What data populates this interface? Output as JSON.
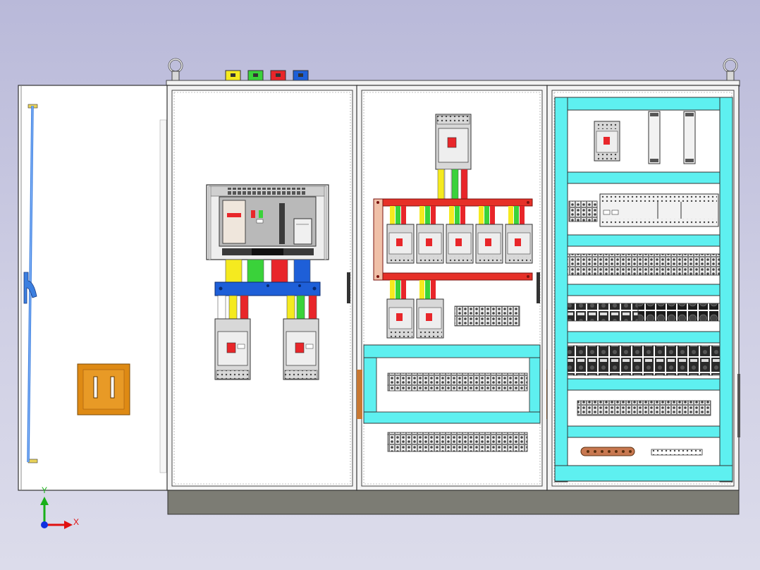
{
  "cad_view": {
    "axis_triad": {
      "x_label": "X",
      "y_label": "Y",
      "x_color": "#e01010",
      "y_color": "#19b019",
      "z_color": "#1030e0"
    }
  },
  "cabinet": {
    "colors": {
      "phase_yellow": "#f5ea1f",
      "phase_green": "#3ad23a",
      "phase_red": "#e8262a",
      "neutral_blue": "#1e5fd8",
      "busbar_red": "#e63028",
      "mounting_rail_cyan": "#5ef0f0",
      "plinth_gray": "#7c7c74",
      "door_lock_orange": "#de8a14",
      "copper_bar": "#c87850"
    },
    "phase_terminal_caps": [
      "yellow",
      "green",
      "red",
      "blue"
    ],
    "sections": [
      {
        "name": "hinged-door",
        "contents": [
          "door-handle-rod",
          "lock-plate"
        ]
      },
      {
        "name": "incoming-section",
        "contents": [
          "air-circuit-breaker",
          "neutral-busbar",
          "molded-case-breaker",
          "molded-case-breaker"
        ]
      },
      {
        "name": "distribution-section",
        "contents": [
          "main-breaker",
          "phase-busbar-frame",
          "outgoing-breakers-5",
          "outgoing-breakers-2",
          "terminal-rows"
        ]
      },
      {
        "name": "control-section",
        "contents": [
          "control-breaker",
          "din-rail-modules",
          "plc-modules",
          "relay-rows",
          "terminal-strip",
          "copper-ground-bar"
        ]
      }
    ]
  }
}
